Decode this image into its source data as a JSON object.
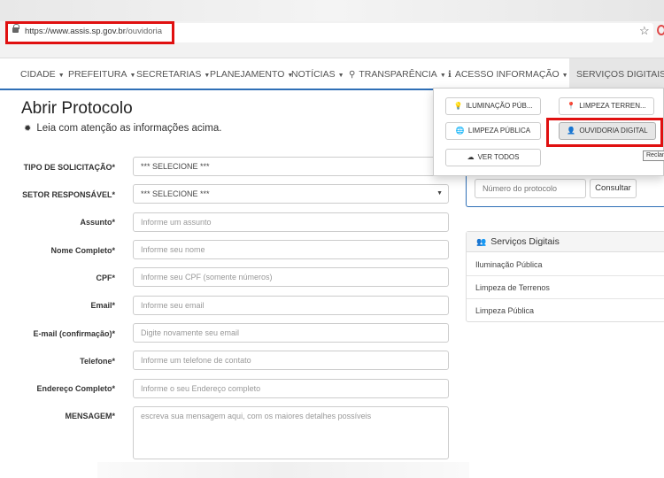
{
  "browser": {
    "url_host": "https://www.assis.sp.gov.br",
    "url_path": "/ouvidoria"
  },
  "nav": {
    "items": [
      {
        "label": "CIDADE"
      },
      {
        "label": "PREFEITURA"
      },
      {
        "label": "SECRETARIAS"
      },
      {
        "label": "PLANEJAMENTO"
      },
      {
        "label": "NOTÍCIAS"
      },
      {
        "label": "TRANSPARÊNCIA",
        "icon": "search-icon"
      },
      {
        "label": "ACESSO INFORMAÇÃO",
        "icon": "info-icon"
      },
      {
        "label": "SERVIÇOS DIGITAIS",
        "active": true
      }
    ],
    "caret": "▼"
  },
  "dropdown": {
    "items": [
      {
        "label": "ILUMINAÇÃO PÚB...",
        "icon": "lightbulb-icon"
      },
      {
        "label": "LIMPEZA TERREN...",
        "icon": "map-marker-icon"
      },
      {
        "label": "LIMPEZA PÚBLICA",
        "icon": "globe-icon"
      },
      {
        "label": "OUVIDORIA DIGITAL",
        "icon": "user-icon",
        "selected": true
      },
      {
        "label": "VER TODOS",
        "icon": "cloud-icon"
      }
    ],
    "tooltip": "Reclamações"
  },
  "page": {
    "title": "Abrir Protocolo",
    "notice": "Leia com atenção as informações acima."
  },
  "form": {
    "fields": [
      {
        "label": "TIPO DE SOLICITAÇÃO*",
        "value": "*** SELECIONE ***",
        "type": "select"
      },
      {
        "label": "SETOR RESPONSÁVEL*",
        "value": "*** SELECIONE ***",
        "type": "select"
      },
      {
        "label": "Assunto*",
        "placeholder": "Informe um assunto"
      },
      {
        "label": "Nome Completo*",
        "placeholder": "Informe seu nome"
      },
      {
        "label": "CPF*",
        "placeholder": "Informe seu CPF (somente números)"
      },
      {
        "label": "Email*",
        "placeholder": "Informe seu email"
      },
      {
        "label": "E-mail (confirmação)*",
        "placeholder": "Digite novamente seu email"
      },
      {
        "label": "Telefone*",
        "placeholder": "Informe um telefone de contato"
      },
      {
        "label": "Endereço Completo*",
        "placeholder": "Informe o seu Endereço completo"
      },
      {
        "label": "MENSAGEM*",
        "placeholder": "escreva sua mensagem aqui, com os maiores detalhes possíveis",
        "type": "textarea"
      }
    ]
  },
  "protocol": {
    "placeholder": "Número do protocolo",
    "button": "Consultar"
  },
  "services": {
    "title": "Serviços Digitais",
    "items": [
      "Iluminação Pública",
      "Limpeza de Terrenos",
      "Limpeza Pública"
    ]
  },
  "colors": {
    "accent": "#2f6fb6",
    "highlight": "#e01010"
  }
}
